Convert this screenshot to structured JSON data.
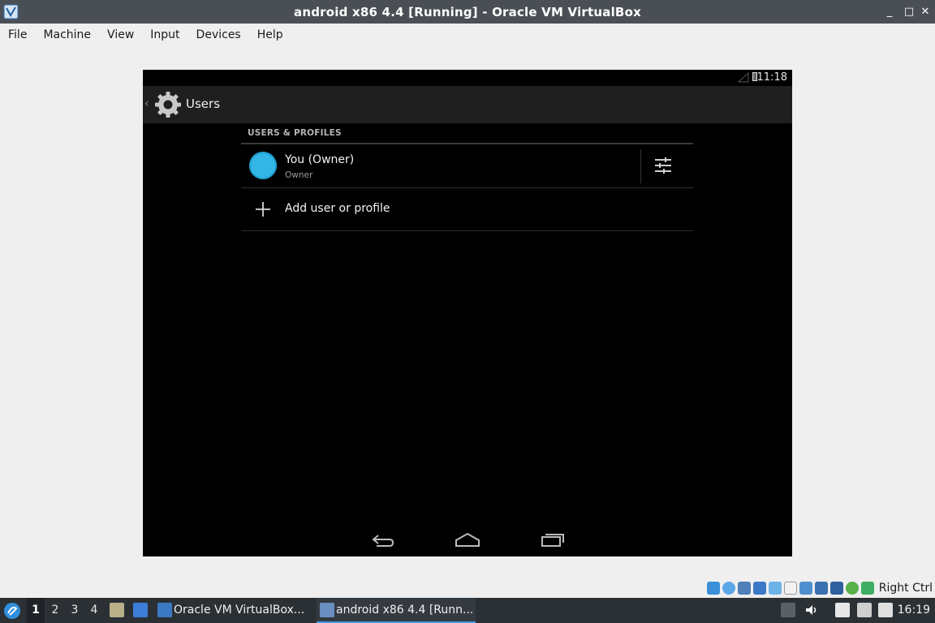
{
  "window": {
    "title": "android x86 4.4 [Running] - Oracle VM VirtualBox",
    "controls": [
      "_",
      "□",
      "✕"
    ]
  },
  "menubar": [
    "File",
    "Machine",
    "View",
    "Input",
    "Devices",
    "Help"
  ],
  "android": {
    "status_time": "11:18",
    "actionbar_title": "Users",
    "section_header": "USERS & PROFILES",
    "owner": {
      "name": "You (Owner)",
      "subtitle": "Owner"
    },
    "add_label": "Add user or profile",
    "colors": {
      "avatar": "#33b5e5",
      "actionbar": "#1f1f1f"
    }
  },
  "vbox_status": {
    "host_key": "Right Ctrl"
  },
  "taskbar": {
    "workspaces": [
      "1",
      "2",
      "3",
      "4"
    ],
    "active_workspace": "1",
    "tasks": [
      {
        "label": "Oracle VM VirtualBox..."
      },
      {
        "label": "android x86 4.4 [Runn..."
      }
    ],
    "clock": "16:19"
  }
}
